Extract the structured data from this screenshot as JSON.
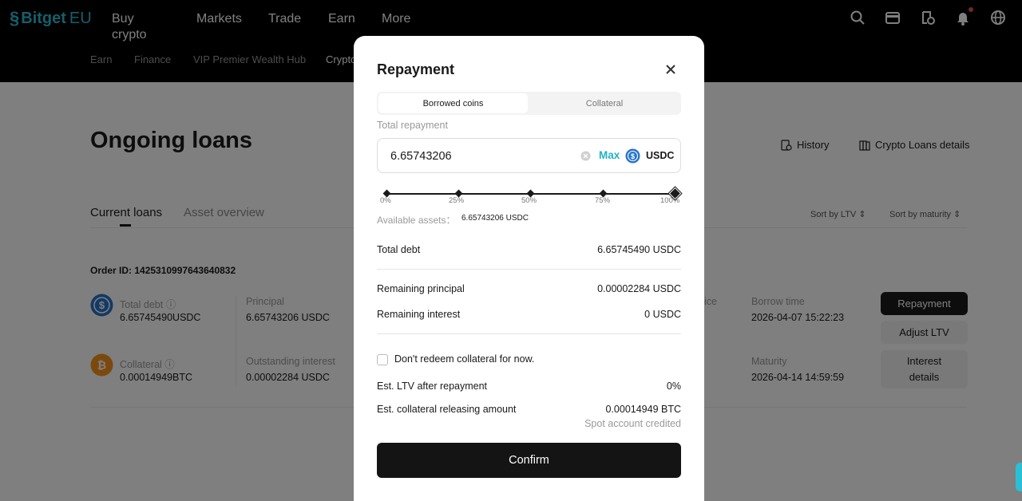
{
  "brand": {
    "name": "Bitget",
    "region": "EU"
  },
  "main_nav": [
    "Buy crypto",
    "Markets",
    "Trade",
    "Earn",
    "More"
  ],
  "top_icons": [
    "search-icon",
    "wallet-icon",
    "orders-icon",
    "bell-icon",
    "globe-icon"
  ],
  "sub_nav": [
    "Earn",
    "Finance",
    "VIP Premier Wealth Hub",
    "Crypto"
  ],
  "page": {
    "title": "Ongoing loans",
    "history": "History",
    "details": "Crypto Loans details",
    "tabs": {
      "current": "Current loans",
      "asset": "Asset overview"
    },
    "sort_ltv": "Sort by LTV",
    "sort_maturity": "Sort by maturity",
    "order_id": "Order ID: 1425310997643640832",
    "loan": {
      "total_debt_label": "Total debt",
      "total_debt_value": "6.65745490USDC",
      "principal_label": "Principal",
      "principal_value": "6.65743206 USDC",
      "price_label_fragment": "ice",
      "borrow_time_label": "Borrow time",
      "borrow_time_value": "2026-04-07 15:22:23",
      "collateral_label": "Collateral",
      "collateral_value": "0.00014949BTC",
      "outstanding_label": "Outstanding interest",
      "outstanding_value": "0.00002284 USDC",
      "maturity_label": "Maturity",
      "maturity_value": "2026-04-14 14:59:59"
    },
    "buttons": {
      "repayment": "Repayment",
      "adjust": "Adjust LTV",
      "interest": "Interest details"
    }
  },
  "modal": {
    "title": "Repayment",
    "tabs": {
      "borrowed": "Borrowed coins",
      "collateral": "Collateral"
    },
    "total_repayment_label": "Total repayment",
    "amount_value": "6.65743206",
    "max_label": "Max",
    "coin": "USDC",
    "slider": {
      "ticks": [
        "0%",
        "25%",
        "50%",
        "75%",
        "100%"
      ],
      "value_percent": 100
    },
    "available_label": "Available assets：",
    "available_value": "6.65743206 USDC",
    "rows": {
      "total_debt_label": "Total debt",
      "total_debt_value": "6.65745490 USDC",
      "remaining_principal_label": "Remaining principal",
      "remaining_principal_value": "0.00002284 USDC",
      "remaining_interest_label": "Remaining interest",
      "remaining_interest_value": "0 USDC",
      "est_ltv_label": "Est. LTV after repayment",
      "est_ltv_value": "0%",
      "est_release_label": "Est. collateral releasing amount",
      "est_release_value": "0.00014949 BTC",
      "spot_note": "Spot account credited"
    },
    "checkbox_label": "Don't redeem collateral for now.",
    "confirm": "Confirm"
  },
  "colors": {
    "accent": "#21b2c8",
    "usdc": "#2775ca",
    "btc": "#f7931a",
    "dark_button": "#141414"
  }
}
